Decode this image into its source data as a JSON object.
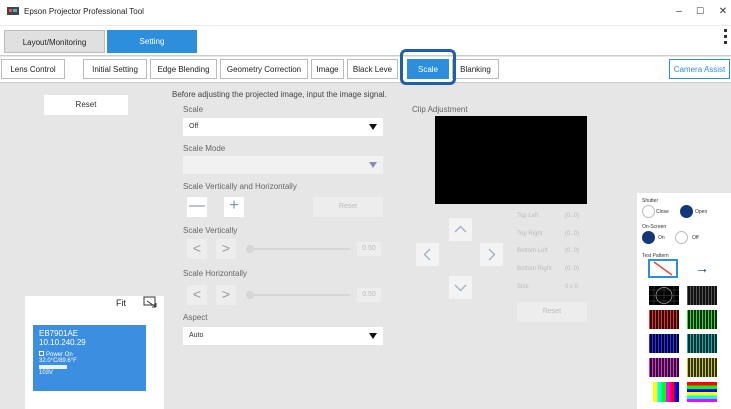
{
  "window": {
    "title": "Epson Projector Professional Tool",
    "minimize": "–",
    "maximize": "☐",
    "close": "✕"
  },
  "main_tabs": {
    "layout": "Layout/Monitoring",
    "setting": "Setting"
  },
  "sub_tabs": [
    "Lens Control",
    "Initial Setting",
    "Edge Blending",
    "Geometry Correction",
    "Image",
    "Black Leve",
    "Scale",
    "Blanking"
  ],
  "camera_assist": "Camera Assist",
  "left": {
    "reset": "Reset"
  },
  "scale": {
    "notice": "Before adjusting the projected image, input the image signal.",
    "scale_label": "Scale",
    "scale_value": "Off",
    "mode_label": "Scale Mode",
    "mode_value": "",
    "vh_label": "Scale Vertically and Horizontally",
    "minus": "—",
    "plus": "+",
    "reset": "Reset",
    "vert_label": "Scale Vertically",
    "vert_value": "0.50",
    "horiz_label": "Scale Horizontally",
    "horiz_value": "0.50",
    "aspect_label": "Aspect",
    "aspect_value": "Auto",
    "left_arrow": "<",
    "right_arrow": ">"
  },
  "clip": {
    "title": "Clip Adjustment",
    "stats": [
      {
        "label": "Top Left",
        "value": "(0, 0)"
      },
      {
        "label": "Top Right",
        "value": "(0, 0)"
      },
      {
        "label": "Bottom Left",
        "value": "(0, 0)"
      },
      {
        "label": "Bottom Right",
        "value": "(0, 0)"
      },
      {
        "label": "Size",
        "value": "0 x 0"
      }
    ],
    "reset": "Reset"
  },
  "device": {
    "fit": "Fit",
    "name": "EB7901AE",
    "ip": "10.10.240.29",
    "power": "Power On",
    "temp": "32.0°C/89.6°F",
    "voltage": "103V"
  },
  "panel": {
    "shutter": "Shutter",
    "close": "Close",
    "open": "Open",
    "onscreen": "On-Screen",
    "on": "On",
    "off": "Off",
    "test_pattern": "Test Pattern",
    "arrow": "→"
  },
  "colors": {
    "accent": "#2e8ede",
    "highlight": "#1f5fa8",
    "device_card": "#3c8ee0",
    "radio_on": "#14377a"
  }
}
